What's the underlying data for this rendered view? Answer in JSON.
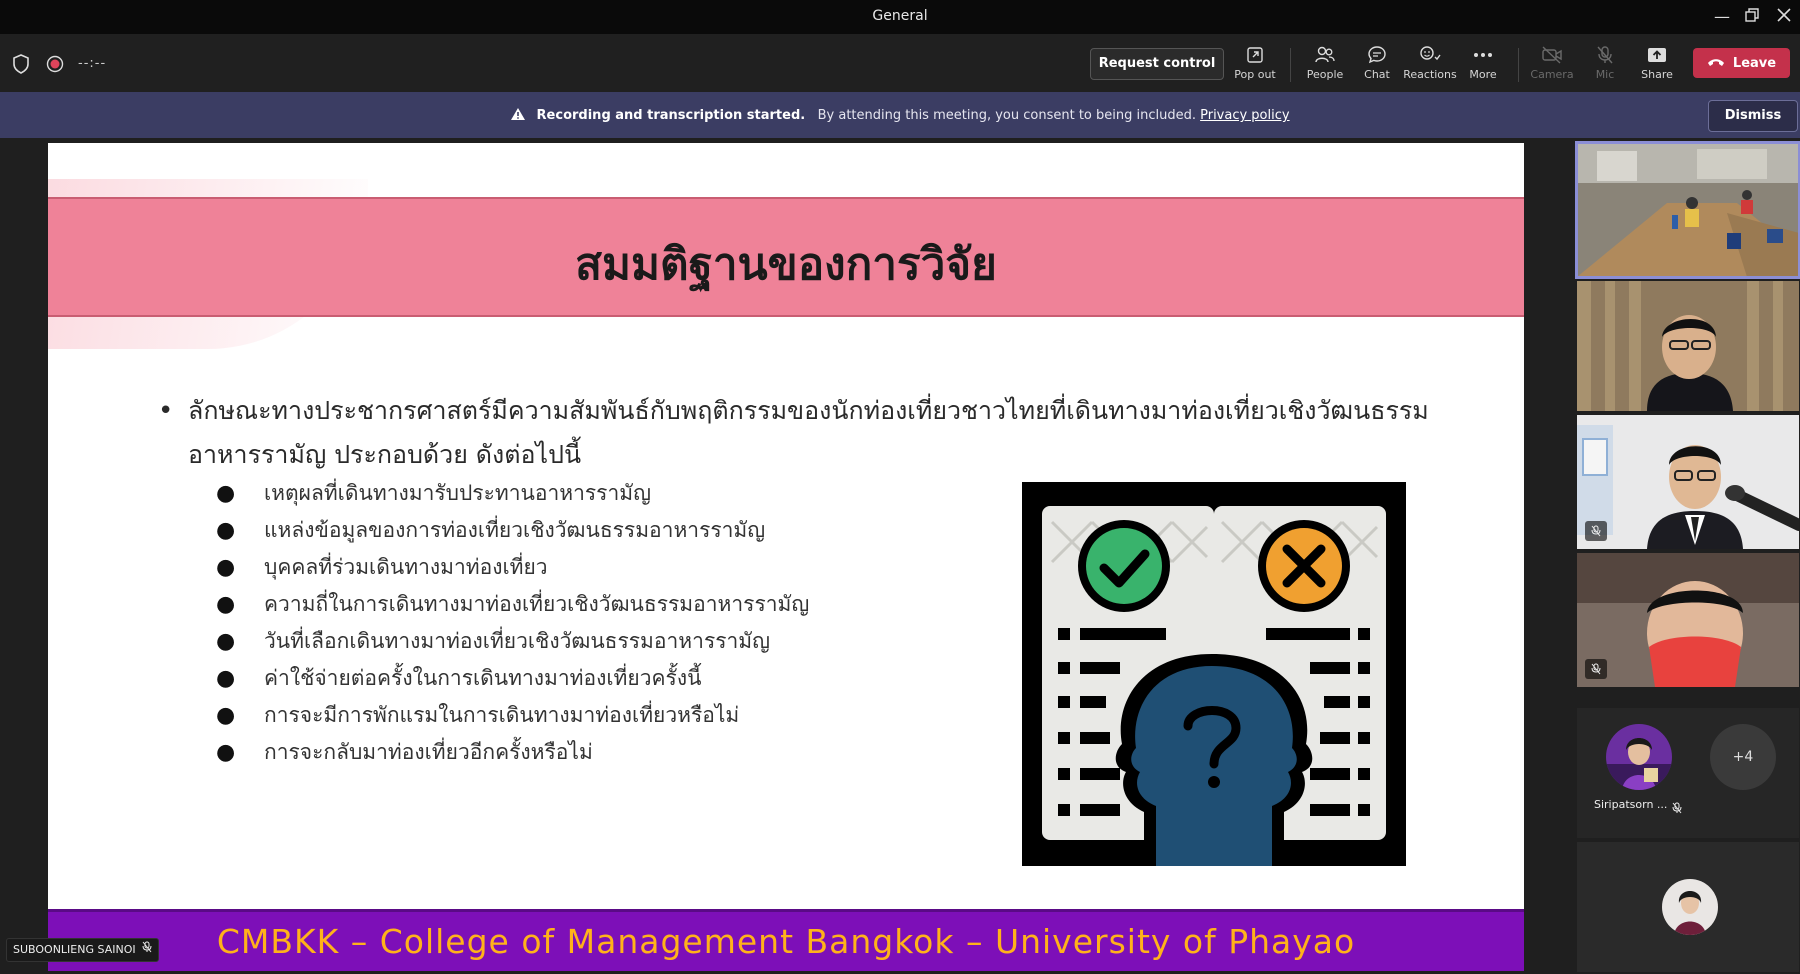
{
  "window": {
    "title": "General"
  },
  "toolbar": {
    "timer": "--:--",
    "request_control": "Request control",
    "tools": [
      {
        "label": "Pop out",
        "icon": "pop-out-icon"
      },
      {
        "label": "People",
        "icon": "people-icon"
      },
      {
        "label": "Chat",
        "icon": "chat-icon"
      },
      {
        "label": "Reactions",
        "icon": "reactions-icon"
      },
      {
        "label": "More",
        "icon": "more-icon"
      },
      {
        "label": "Camera",
        "icon": "camera-off-icon"
      },
      {
        "label": "Mic",
        "icon": "mic-off-icon"
      },
      {
        "label": "Share",
        "icon": "share-icon"
      }
    ],
    "leave": "Leave"
  },
  "banner": {
    "bold": "Recording and transcription started.",
    "text": "By attending this meeting, you consent to being included.",
    "link": "Privacy policy",
    "dismiss": "Dismiss"
  },
  "slide": {
    "title": "สมมติฐานของการวิจัย",
    "main_bullet_line1": "ลักษณะทางประชากรศาสตร์มีความสัมพันธ์กับพฤติกรรมของนักท่องเที่ยวชาวไทยที่เดินทางมาท่องเที่ยวเชิงวัฒนธรรม",
    "main_bullet_line2": "อาหารรามัญ ประกอบด้วย ดังต่อไปนี้",
    "sub_bullets": [
      "เหตุผลที่เดินทางมารับประทานอาหารรามัญ",
      "แหล่งข้อมูลของการท่องเที่ยวเชิงวัฒนธรรมอาหารรามัญ",
      "บุคคลที่ร่วมเดินทางมาท่องเที่ยว",
      "ความถี่ในการเดินทางมาท่องเที่ยวเชิงวัฒนธรรมอาหารรามัญ",
      "วันที่เลือกเดินทางมาท่องเที่ยวเชิงวัฒนธรรมอาหารรามัญ",
      "ค่าใช้จ่ายต่อครั้งในการเดินทางมาท่องเที่ยวครั้งนี้",
      "การจะมีการพักแรมในการเดินทางมาท่องเที่ยวหรือไม่",
      "การจะกลับมาท่องเที่ยวอีกครั้งหรือไม่"
    ],
    "footer": "CMBKK – College of Management Bangkok – University of Phayao"
  },
  "presenter_label": "SUBOONLIENG SAINOI",
  "participants": {
    "avatar_name": "Siripatsorn ...",
    "more_count": "+4"
  },
  "colors": {
    "header_band": "#ef8298",
    "footer_band": "#7d0fb8",
    "footer_text": "#ffb21a",
    "leave": "#c4314b",
    "banner": "#3b3d63"
  }
}
